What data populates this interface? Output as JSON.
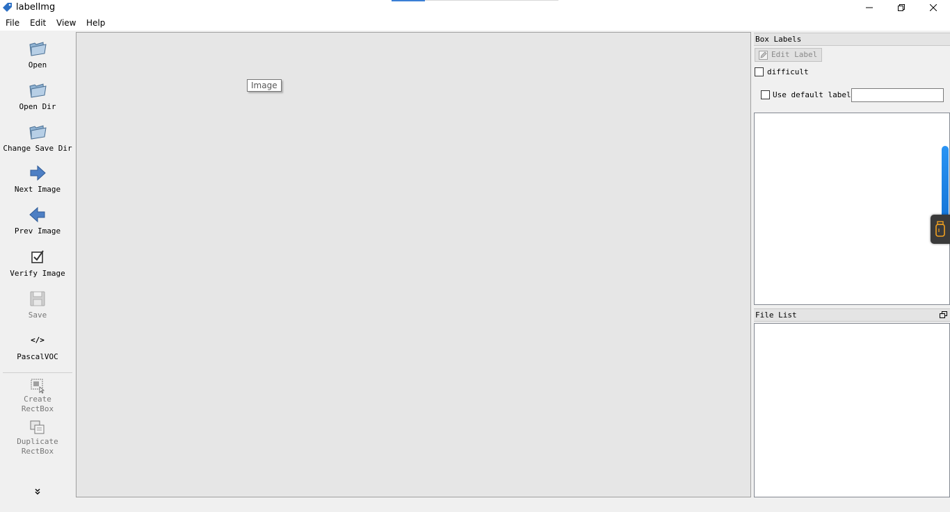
{
  "window": {
    "title": "labelImg",
    "controls": [
      "minimize",
      "restore",
      "close"
    ]
  },
  "menu": {
    "items": [
      "File",
      "Edit",
      "View",
      "Help"
    ]
  },
  "toolbar": {
    "open": "Open",
    "open_dir": "Open Dir",
    "change_save_dir": "Change Save Dir",
    "next_image": "Next Image",
    "prev_image": "Prev Image",
    "verify_image": "Verify Image",
    "save": "Save",
    "format": "PascalVOC",
    "format_icon_text": "</>",
    "create_rectbox_line1": "Create",
    "create_rectbox_line2": "RectBox",
    "duplicate_rectbox_line1": "Duplicate",
    "duplicate_rectbox_line2": "RectBox"
  },
  "canvas": {
    "tooltip": "Image"
  },
  "box_labels": {
    "header": "Box Labels",
    "edit_label": "Edit Label",
    "difficult": "difficult",
    "difficult_checked": false,
    "use_default_label": "Use default label",
    "use_default_checked": false,
    "default_label_value": ""
  },
  "file_list": {
    "header": "File List"
  },
  "colors": {
    "accent": "#3a7fd5",
    "canvas_bg": "#e6e6e6",
    "panel_bg": "#f0f0f0",
    "scroll_indicator": "#1e88e5"
  }
}
